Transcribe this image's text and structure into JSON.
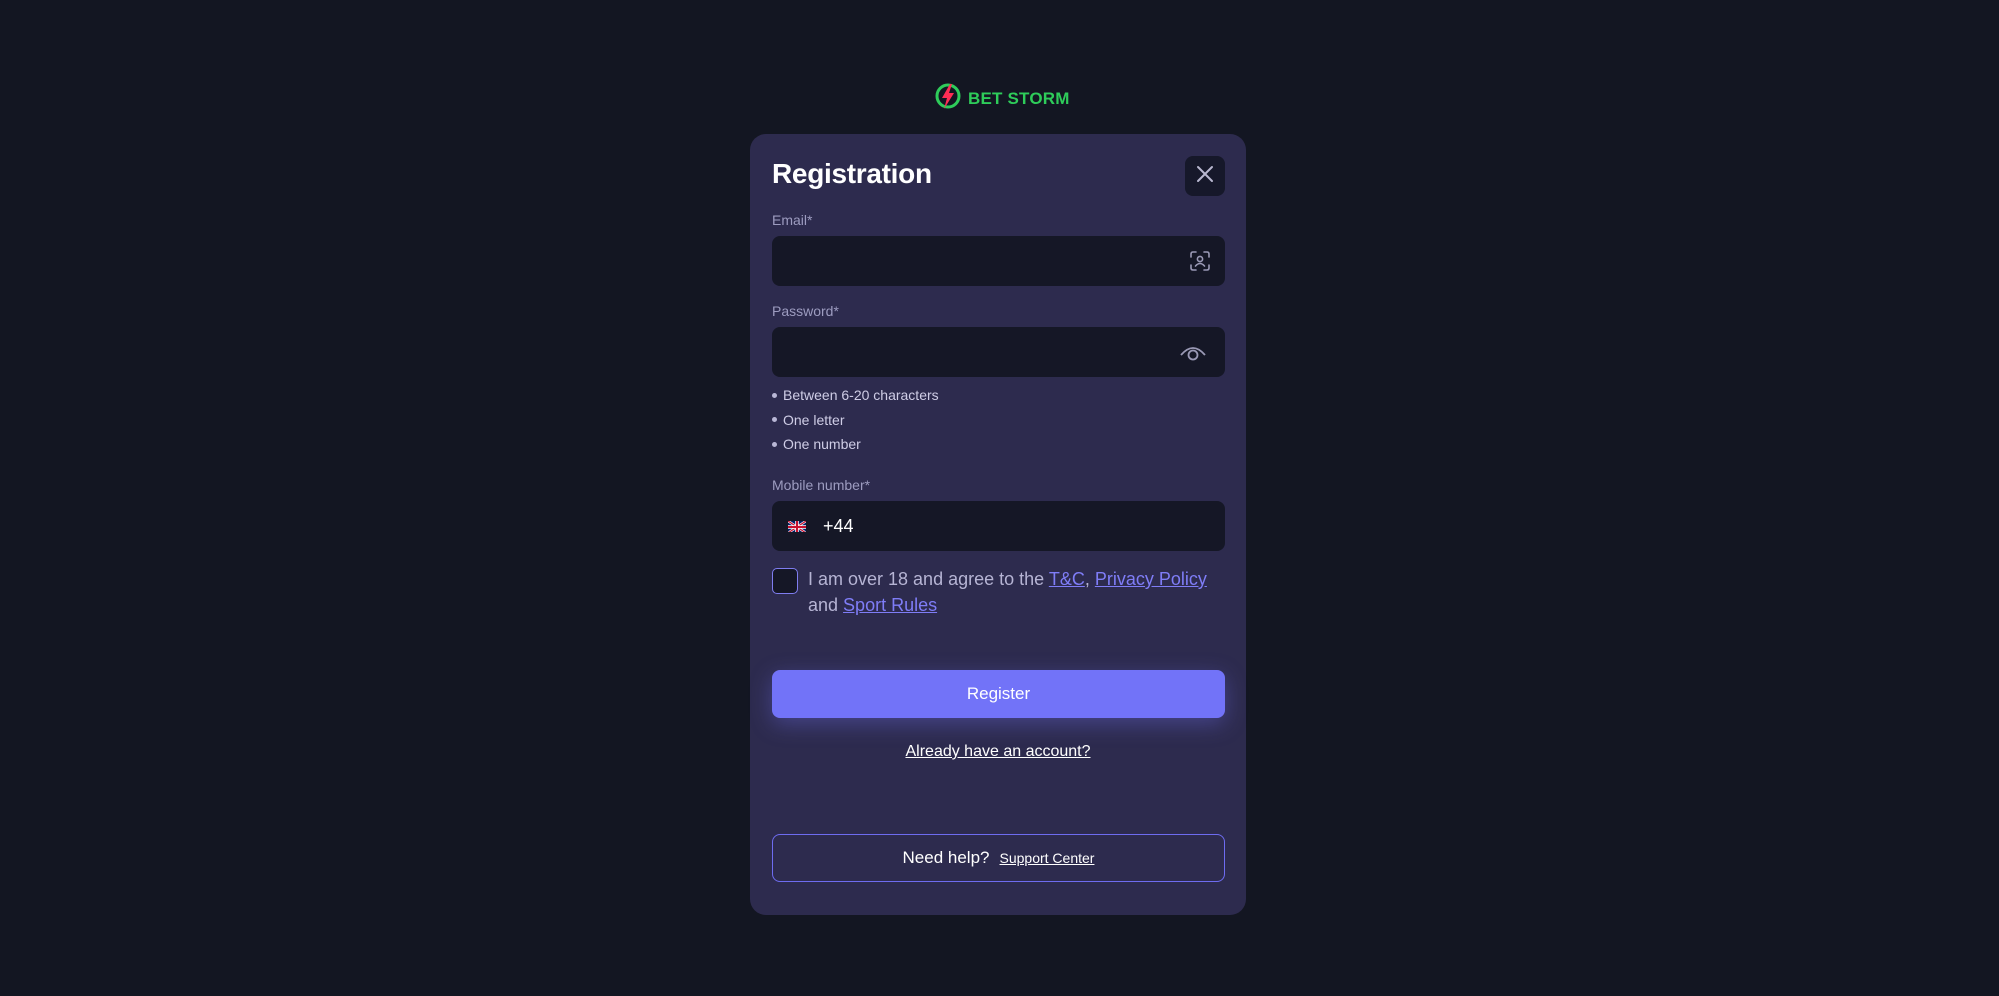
{
  "brand": {
    "name": "BET STORM",
    "color": "#2ecc5a",
    "icon": "lightning-bolt-icon"
  },
  "registration": {
    "title": "Registration",
    "close_icon": "close-icon",
    "email": {
      "label": "Email*",
      "value": "",
      "placeholder": "",
      "icon": "face-scan-icon"
    },
    "password": {
      "label": "Password*",
      "value": "",
      "placeholder": "",
      "icon": "eye-icon",
      "rules": [
        "Between 6-20 characters",
        "One letter",
        "One number"
      ]
    },
    "mobile": {
      "label": "Mobile number*",
      "flag_icon": "uk-flag-icon",
      "dial_code": "+44",
      "value": ""
    },
    "agreement": {
      "checked": false,
      "prefix": "I am over 18 and agree to the ",
      "tc_link": "T&C",
      "sep1": ", ",
      "privacy_link": "Privacy Policy",
      "sep2": " and ",
      "sport_rules_link": "Sport Rules"
    },
    "register_label": "Register",
    "login_link": "Already have an account?",
    "help": {
      "text": "Need help?",
      "link": "Support Center"
    }
  },
  "colors": {
    "background": "#131622",
    "panel": "#2d2b4e",
    "input": "#151726",
    "accent": "#7273f8",
    "link": "#7f7df7"
  }
}
